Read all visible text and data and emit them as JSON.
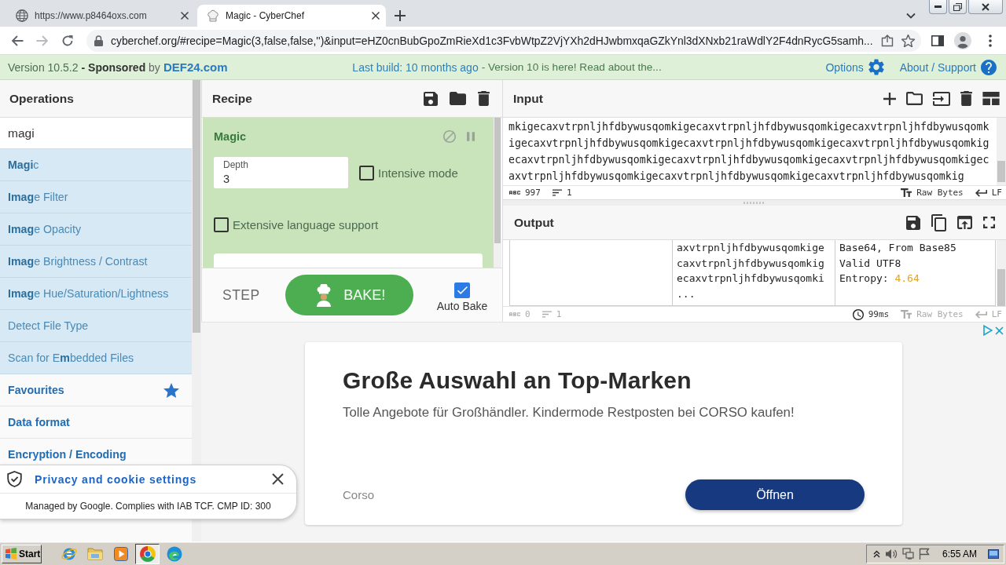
{
  "browser": {
    "tabs": [
      {
        "kind": "web",
        "title": "https://www.p8464oxs.com",
        "selected": false
      },
      {
        "kind": "app",
        "title": "Magic - CyberChef",
        "selected": true
      }
    ],
    "url": "cyberchef.org/#recipe=Magic(3,false,false,'')&input=eHZ0cnBubGpoZmRieXd1c3FvbWtpZ2VjYXh2dHJwbmxqaGZkYnl3dXNxb21raWdlY2F4dnRycG5samh..."
  },
  "banner": {
    "version": "Version 10.5.2",
    "sponsor": "**- Sponsored** by",
    "sponsor_link": "DEF24.com",
    "last_build": "Last build: 10 months ago",
    "notice": "- Version 10 is here! Read about the...",
    "links": [
      {
        "kind": "options",
        "label": "Options"
      },
      {
        "kind": "support",
        "label": "About / Support"
      }
    ]
  },
  "operations": {
    "title": "Operations",
    "search": {
      "value": "magi"
    },
    "items": [
      {
        "kind": "result",
        "label": "**Magi**c"
      },
      {
        "kind": "result",
        "label": "**Imag**e Filter"
      },
      {
        "kind": "result",
        "label": "**Imag**e Opacity"
      },
      {
        "kind": "result",
        "label": "**Imag**e Brightness / Contrast"
      },
      {
        "kind": "result",
        "label": "**Imag**e Hue/Saturation/Lightness"
      },
      {
        "kind": "result",
        "label": "Detect File Type"
      },
      {
        "kind": "result",
        "label": "Scan for E**m**bedded Files"
      },
      {
        "kind": "favourites",
        "label": "Favourites"
      },
      {
        "kind": "category",
        "label": "Data format"
      },
      {
        "kind": "category",
        "label": "Encryption / Encoding"
      }
    ]
  },
  "recipe": {
    "title": "Recipe",
    "operation": {
      "name": "Magic",
      "disabled": false,
      "breakpoint": false,
      "args": [
        {
          "kind": "number",
          "label": "Depth",
          "value": "3"
        },
        {
          "kind": "checkbox",
          "label": "Intensive mode",
          "checked": false
        },
        {
          "kind": "checkbox",
          "label": "Extensive language support",
          "checked": false
        },
        {
          "kind": "text"
        }
      ]
    },
    "step": "STEP",
    "bake": "BAKE!",
    "auto_bake": {
      "label": "Auto Bake",
      "checked": true
    }
  },
  "input": {
    "title": "Input",
    "lines": [
      "mkigecaxvtrpnljhfdbywusqomkigecaxvtrpnljhfdbywusqomkigecaxvtrpnljhfdbywusqomk",
      "igecaxvtrpnljhfdbywusqomkigecaxvtrpnljhfdbywusqomkigecaxvtrpnljhfdbywusqomkig",
      "ecaxvtrpnljhfdbywusqomkigecaxvtrpnljhfdbywusqomkigecaxvtrpnljhfdbywusqomkigec",
      "axvtrpnljhfdbywusqomkigecaxvtrpnljhfdbywusqomkigecaxvtrpnljhfdbywusqomkig"
    ],
    "status": [
      {
        "kind": "chars",
        "text": "997",
        "disabled": false
      },
      {
        "kind": "lines",
        "text": "1",
        "disabled": false
      },
      {
        "kind": "encoding",
        "text": "Raw Bytes",
        "disabled": false
      },
      {
        "kind": "eol",
        "text": "LF",
        "disabled": false
      }
    ]
  },
  "output": {
    "title": "Output",
    "cells": [
      {
        "kind": "empty"
      },
      {
        "kind": "text",
        "lines": [
          "axvtrpnljhfdbywusqomkige",
          "caxvtrpnljhfdbywusqomkig",
          "ecaxvtrpnljhfdbywusqomki",
          "..."
        ]
      },
      {
        "kind": "properties",
        "lines": [
          "Base64, From Base85",
          "Valid UTF8"
        ],
        "entropy_label": "Entropy:",
        "entropy_value": "4.64"
      }
    ],
    "status": [
      {
        "kind": "chars",
        "text": "0",
        "disabled": true
      },
      {
        "kind": "lines",
        "text": "1",
        "disabled": true
      },
      {
        "kind": "time",
        "text": "99ms",
        "disabled": false
      },
      {
        "kind": "encoding",
        "text": "Raw Bytes",
        "disabled": true
      },
      {
        "kind": "eol",
        "text": "LF",
        "disabled": true
      }
    ]
  },
  "ad": {
    "title": "Große Auswahl an Top-Marken",
    "text": "Tolle Angebote für Großhändler. Kindermode Restposten bei CORSO kaufen!",
    "advertiser": "Corso",
    "button": "Öffnen"
  },
  "cookie_banner": {
    "title": "Privacy and cookie settings",
    "note": "Managed by Google. Complies with IAB TCF. CMP ID: 300"
  },
  "taskbar": {
    "start": "Start",
    "apps": [
      {
        "kind": "ie",
        "selected": false
      },
      {
        "kind": "folder",
        "selected": false
      },
      {
        "kind": "media",
        "selected": false
      },
      {
        "kind": "chrome",
        "selected": true
      },
      {
        "kind": "edge",
        "selected": false
      }
    ],
    "clock": "6:55 AM"
  }
}
